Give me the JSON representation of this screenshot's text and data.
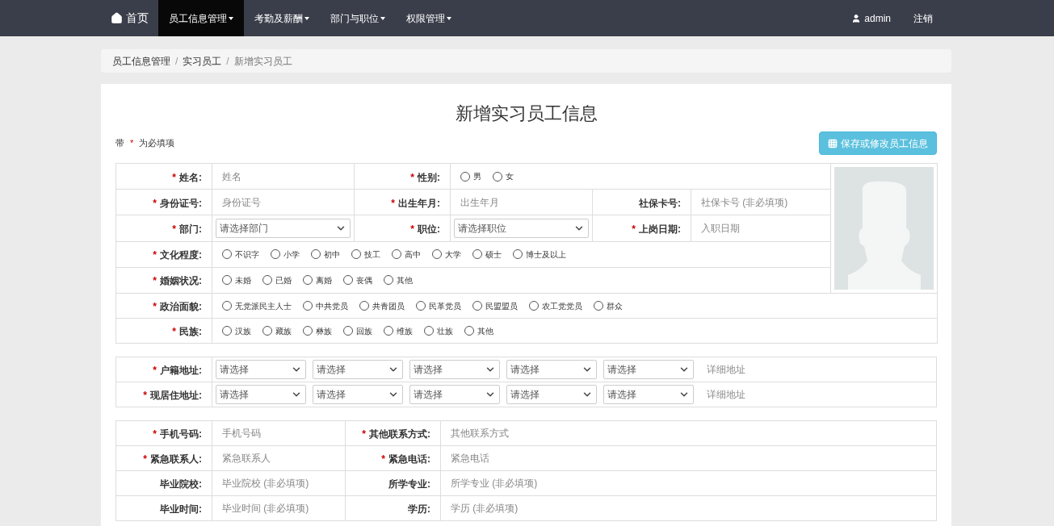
{
  "nav": {
    "home": "首页",
    "items": [
      {
        "label": "员工信息管理",
        "selected": true
      },
      {
        "label": "考勤及薪酬",
        "selected": false
      },
      {
        "label": "部门与职位",
        "selected": false
      },
      {
        "label": "权限管理",
        "selected": false
      }
    ],
    "user": "admin",
    "logout": "注销"
  },
  "breadcrumb": [
    {
      "label": "员工信息管理"
    },
    {
      "separator": "/",
      "label": "实习员工"
    },
    {
      "separator": "/",
      "label": "新增实习员工"
    }
  ],
  "form": {
    "title": "新增实习员工信息",
    "required_note": {
      "prefix": "带",
      "mark": "*",
      "suffix": "为必填项"
    },
    "save_button": "保存或修改员工信息",
    "basic": {
      "name": {
        "label": "姓名:",
        "required_mark": "*",
        "placeholder": "姓名"
      },
      "gender": {
        "label": "性别:",
        "required_mark": "*",
        "options": [
          {
            "label": "男",
            "selected": false
          },
          {
            "label": "女",
            "selected": false
          }
        ]
      },
      "id_card": {
        "label": "身份证号:",
        "required_mark": "*",
        "placeholder": "身份证号"
      },
      "birth": {
        "label": "出生年月:",
        "required_mark": "*",
        "placeholder": "出生年月"
      },
      "social_card": {
        "label": "社保卡号:",
        "placeholder": "社保卡号 (非必填项)"
      },
      "department": {
        "label": "部门:",
        "required_mark": "*",
        "value": "请选择部门"
      },
      "position": {
        "label": "职位:",
        "required_mark": "*",
        "value": "请选择职位"
      },
      "start_date": {
        "label": "上岗日期:",
        "required_mark": "*",
        "placeholder": "入职日期"
      },
      "education": {
        "label": "文化程度:",
        "required_mark": "*",
        "options": [
          {
            "label": "不识字",
            "selected": false
          },
          {
            "label": "小学",
            "selected": false
          },
          {
            "label": "初中",
            "selected": false
          },
          {
            "label": "技工",
            "selected": false
          },
          {
            "label": "高中",
            "selected": false
          },
          {
            "label": "大学",
            "selected": false
          },
          {
            "label": "硕士",
            "selected": false
          },
          {
            "label": "博士及以上",
            "selected": false
          }
        ]
      },
      "marital": {
        "label": "婚姻状况:",
        "required_mark": "*",
        "options": [
          {
            "label": "未婚",
            "selected": false
          },
          {
            "label": "已婚",
            "selected": false
          },
          {
            "label": "离婚",
            "selected": false
          },
          {
            "label": "丧偶",
            "selected": false
          },
          {
            "label": "其他",
            "selected": false
          }
        ]
      },
      "political": {
        "label": "政治面貌:",
        "required_mark": "*",
        "options": [
          {
            "label": "无党派民主人士",
            "selected": false
          },
          {
            "label": "中共党员",
            "selected": false
          },
          {
            "label": "共青团员",
            "selected": false
          },
          {
            "label": "民革党员",
            "selected": false
          },
          {
            "label": "民盟盟员",
            "selected": false
          },
          {
            "label": "农工党党员",
            "selected": false
          },
          {
            "label": "群众",
            "selected": false
          }
        ]
      },
      "ethnicity": {
        "label": "民族:",
        "required_mark": "*",
        "options": [
          {
            "label": "汉族",
            "selected": false
          },
          {
            "label": "藏族",
            "selected": false
          },
          {
            "label": "彝族",
            "selected": false
          },
          {
            "label": "回族",
            "selected": false
          },
          {
            "label": "维族",
            "selected": false
          },
          {
            "label": "壮族",
            "selected": false
          },
          {
            "label": "其他",
            "selected": false
          }
        ]
      }
    },
    "address_rows": [
      {
        "label": "户籍地址:",
        "required_mark": "*",
        "selects": [
          "请选择",
          "请选择",
          "请选择",
          "请选择",
          "请选择"
        ],
        "detail_placeholder": "详细地址"
      },
      {
        "label": "现居住地址:",
        "required_mark": "*",
        "selects": [
          "请选择",
          "请选择",
          "请选择",
          "请选择",
          "请选择"
        ],
        "detail_placeholder": "详细地址"
      }
    ],
    "contact_rows": [
      [
        {
          "label": "手机号码:",
          "required_mark": "*",
          "placeholder": "手机号码"
        },
        {
          "label": "其他联系方式:",
          "required_mark": "*",
          "placeholder": "其他联系方式"
        }
      ],
      [
        {
          "label": "紧急联系人:",
          "required_mark": "*",
          "placeholder": "紧急联系人"
        },
        {
          "label": "紧急电话:",
          "required_mark": "*",
          "placeholder": "紧急电话"
        }
      ],
      [
        {
          "label": "毕业院校:",
          "placeholder": "毕业院校 (非必填项)"
        },
        {
          "label": "所学专业:",
          "placeholder": "所学专业 (非必填项)"
        }
      ],
      [
        {
          "label": "毕业时间:",
          "placeholder": "毕业时间 (非必填项)"
        },
        {
          "label": "学历:",
          "placeholder": "学历 (非必填项)"
        }
      ]
    ]
  }
}
